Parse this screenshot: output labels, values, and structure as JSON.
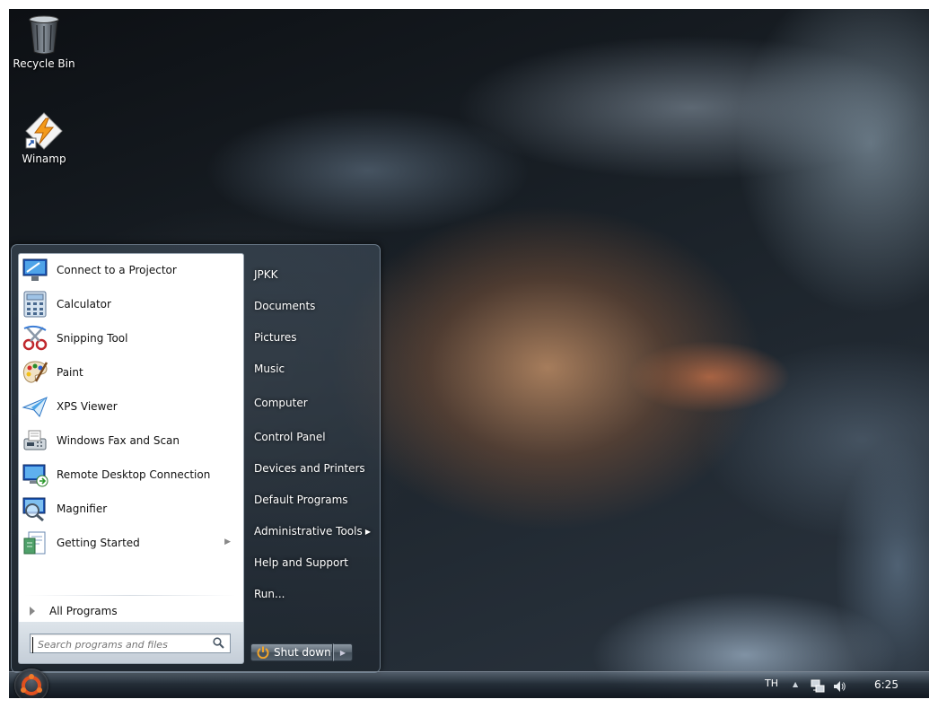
{
  "desktop": {
    "icons": [
      {
        "label": "Recycle Bin"
      },
      {
        "label": "Winamp"
      }
    ]
  },
  "start_menu": {
    "programs": [
      {
        "label": "Connect to a Projector",
        "icon": "projector-icon"
      },
      {
        "label": "Calculator",
        "icon": "calculator-icon"
      },
      {
        "label": "Snipping Tool",
        "icon": "scissors-icon"
      },
      {
        "label": "Paint",
        "icon": "palette-icon"
      },
      {
        "label": "XPS Viewer",
        "icon": "paper-plane-icon"
      },
      {
        "label": "Windows Fax and Scan",
        "icon": "fax-icon"
      },
      {
        "label": "Remote Desktop Connection",
        "icon": "remote-desktop-icon"
      },
      {
        "label": "Magnifier",
        "icon": "magnifier-icon"
      },
      {
        "label": "Getting Started",
        "icon": "getting-started-icon",
        "has_submenu": true
      }
    ],
    "all_programs_label": "All Programs",
    "search_placeholder": "Search programs and files",
    "places": [
      {
        "label": "JPKK"
      },
      {
        "label": "Documents"
      },
      {
        "label": "Pictures"
      },
      {
        "label": "Music"
      },
      {
        "label": "Computer"
      },
      {
        "label": "Control Panel"
      },
      {
        "label": "Devices and Printers"
      },
      {
        "label": "Default Programs"
      },
      {
        "label": "Administrative Tools",
        "has_submenu": true
      },
      {
        "label": "Help and Support"
      },
      {
        "label": "Run..."
      }
    ],
    "shutdown_label": "Shut down"
  },
  "taskbar": {
    "language": "TH",
    "clock": "6:25"
  }
}
